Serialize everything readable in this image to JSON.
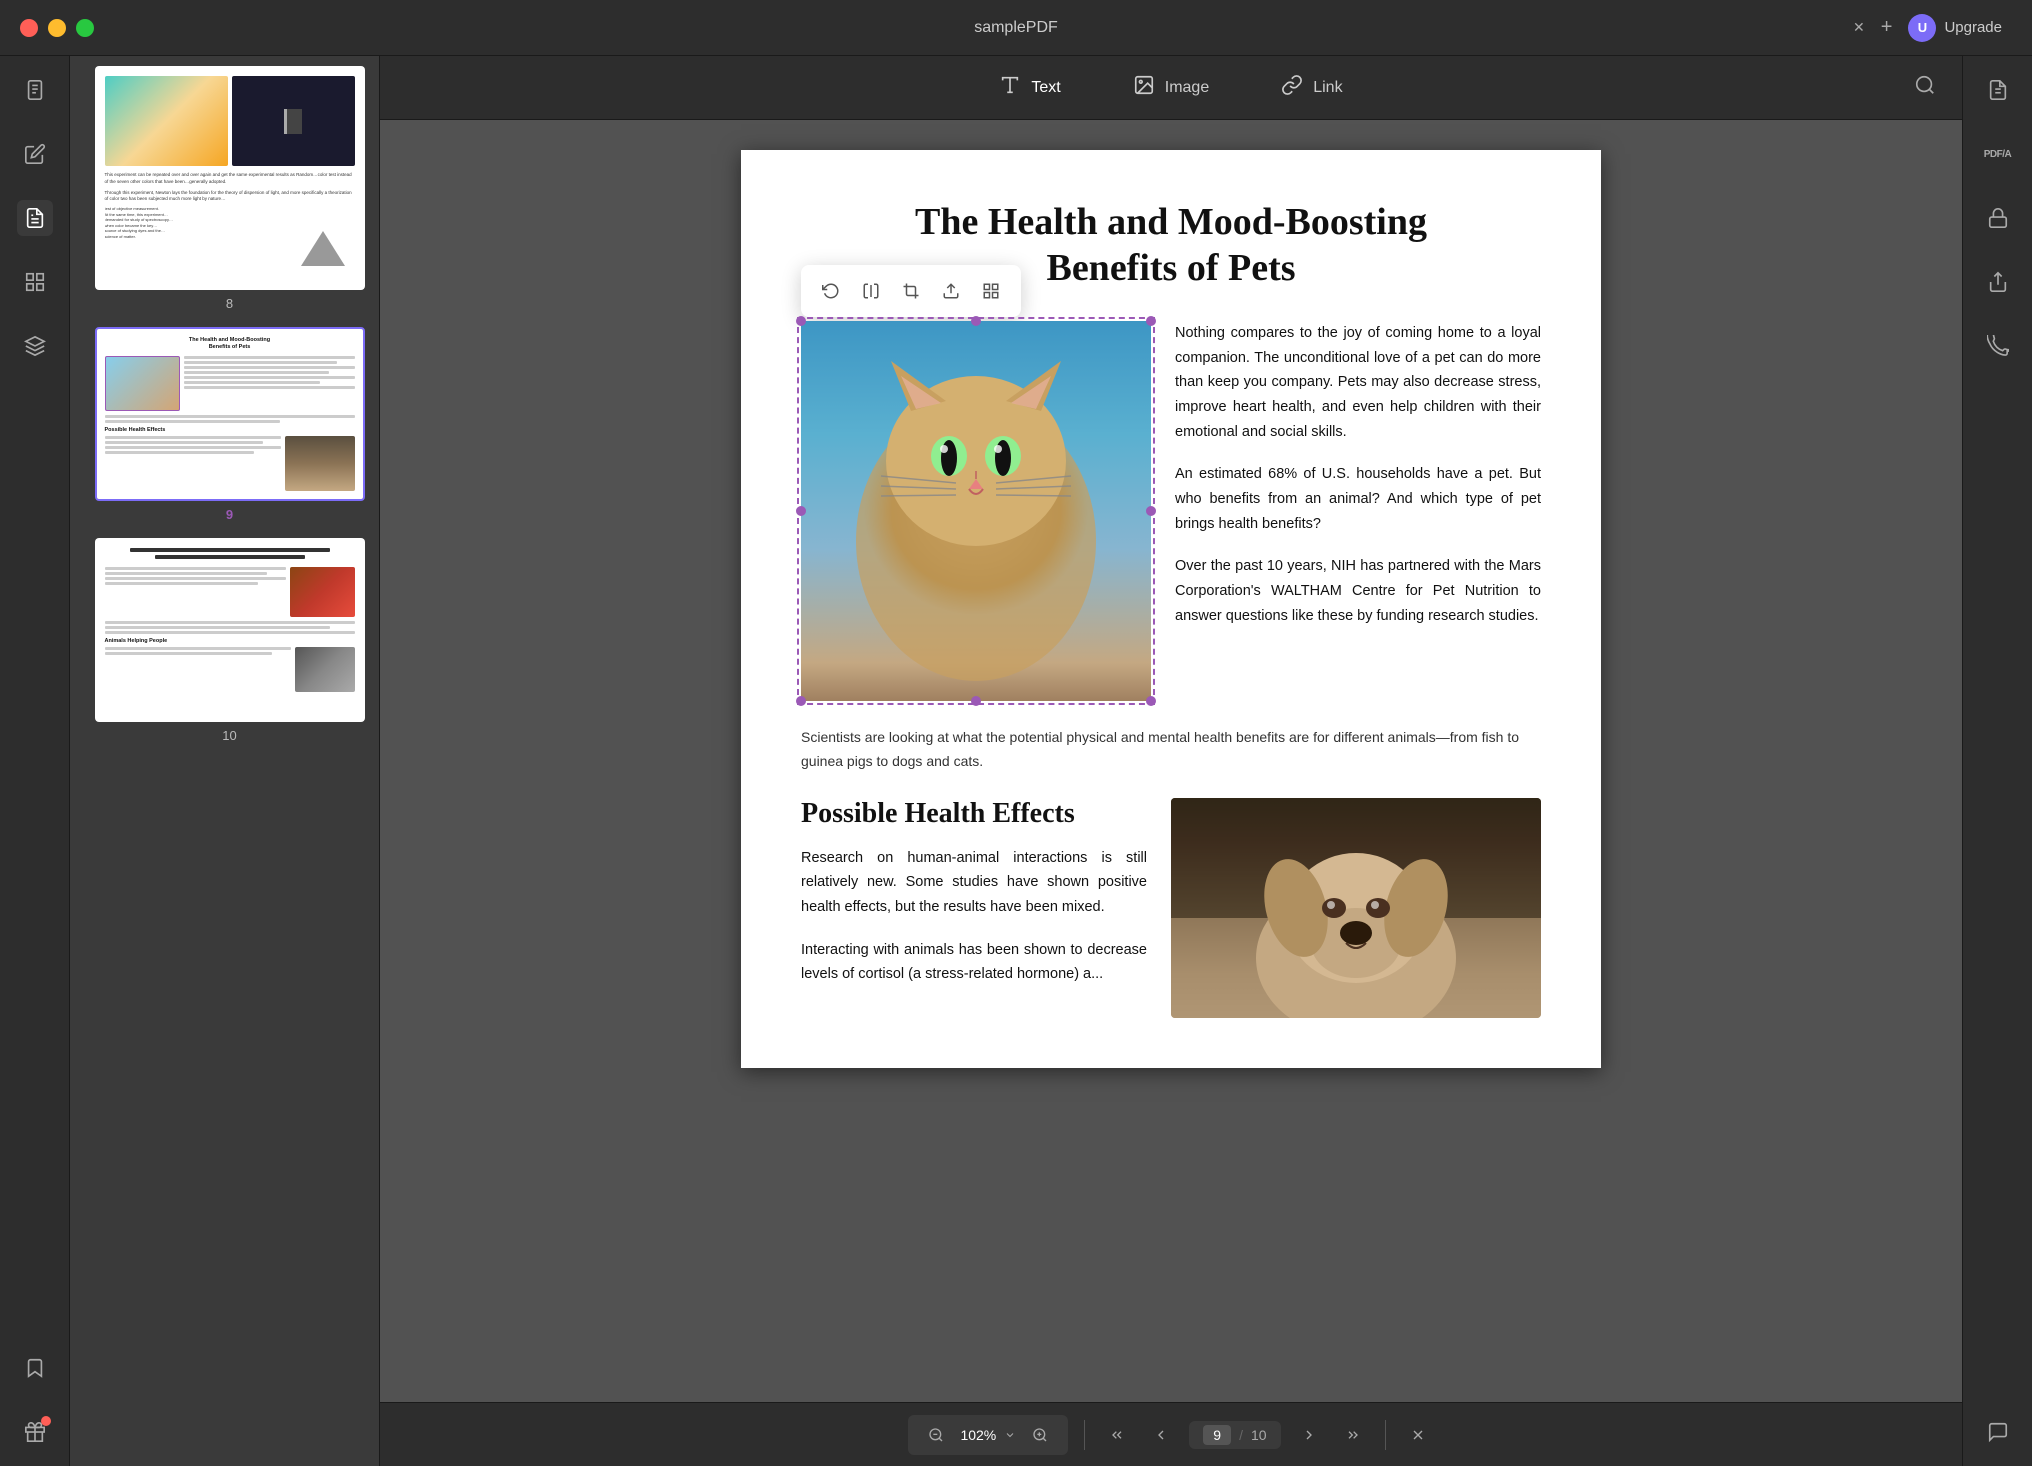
{
  "titlebar": {
    "title": "samplePDF",
    "controls": {
      "red_label": "close",
      "yellow_label": "minimize",
      "green_label": "maximize"
    },
    "upgrade_label": "Upgrade",
    "user_initial": "U"
  },
  "toolbar": {
    "text_tool": "Text",
    "image_tool": "Image",
    "link_tool": "Link"
  },
  "thumbnails": [
    {
      "page_num": "8",
      "active": false
    },
    {
      "page_num": "9",
      "active": true
    },
    {
      "page_num": "10",
      "active": false
    }
  ],
  "pdf_page": {
    "title_line1": "The Health and Mood-Boosting",
    "title_line2": "Benefits of Pets",
    "para1": "Nothing compares to the joy of coming home to a loyal companion. The unconditional love of a pet can do more than keep you company. Pets may also decrease stress, improve heart health, and even help children with their emotional and social skills.",
    "para2": "An estimated 68% of U.S. households have a pet. But who benefits from an animal? And which type of pet brings health benefits?",
    "para3": "Over the past 10 years, NIH has partnered with the Mars Corporation's WALTHAM Centre for Pet Nutrition to answer questions like these by funding research studies.",
    "caption": "Scientists are looking at what the potential physical and mental health benefits are for different animals—from fish to guinea pigs to dogs and cats.",
    "section_title": "Possible Health Effects",
    "section_para1": "Research on human-animal interactions is still relatively new. Some studies have shown positive health effects, but the results have been mixed.",
    "section_para2": "Interacting with animals has been shown to decrease levels of cortisol (a stress-related hormone) a..."
  },
  "image_toolbar": {
    "crop_icon": "crop",
    "flip_icon": "flip",
    "rotate_icon": "rotate",
    "replace_icon": "replace",
    "more_icon": "more"
  },
  "bottom_bar": {
    "zoom_value": "102%",
    "page_current": "9",
    "page_total": "10"
  },
  "right_sidebar": {
    "icons": [
      "convert-pdf",
      "pdf-lock",
      "share",
      "email",
      "chat"
    ]
  },
  "left_sidebar": {
    "icons": [
      "document",
      "edit",
      "annotate",
      "organize",
      "layers",
      "bookmark"
    ],
    "bottom_icons": [
      "gift"
    ]
  }
}
